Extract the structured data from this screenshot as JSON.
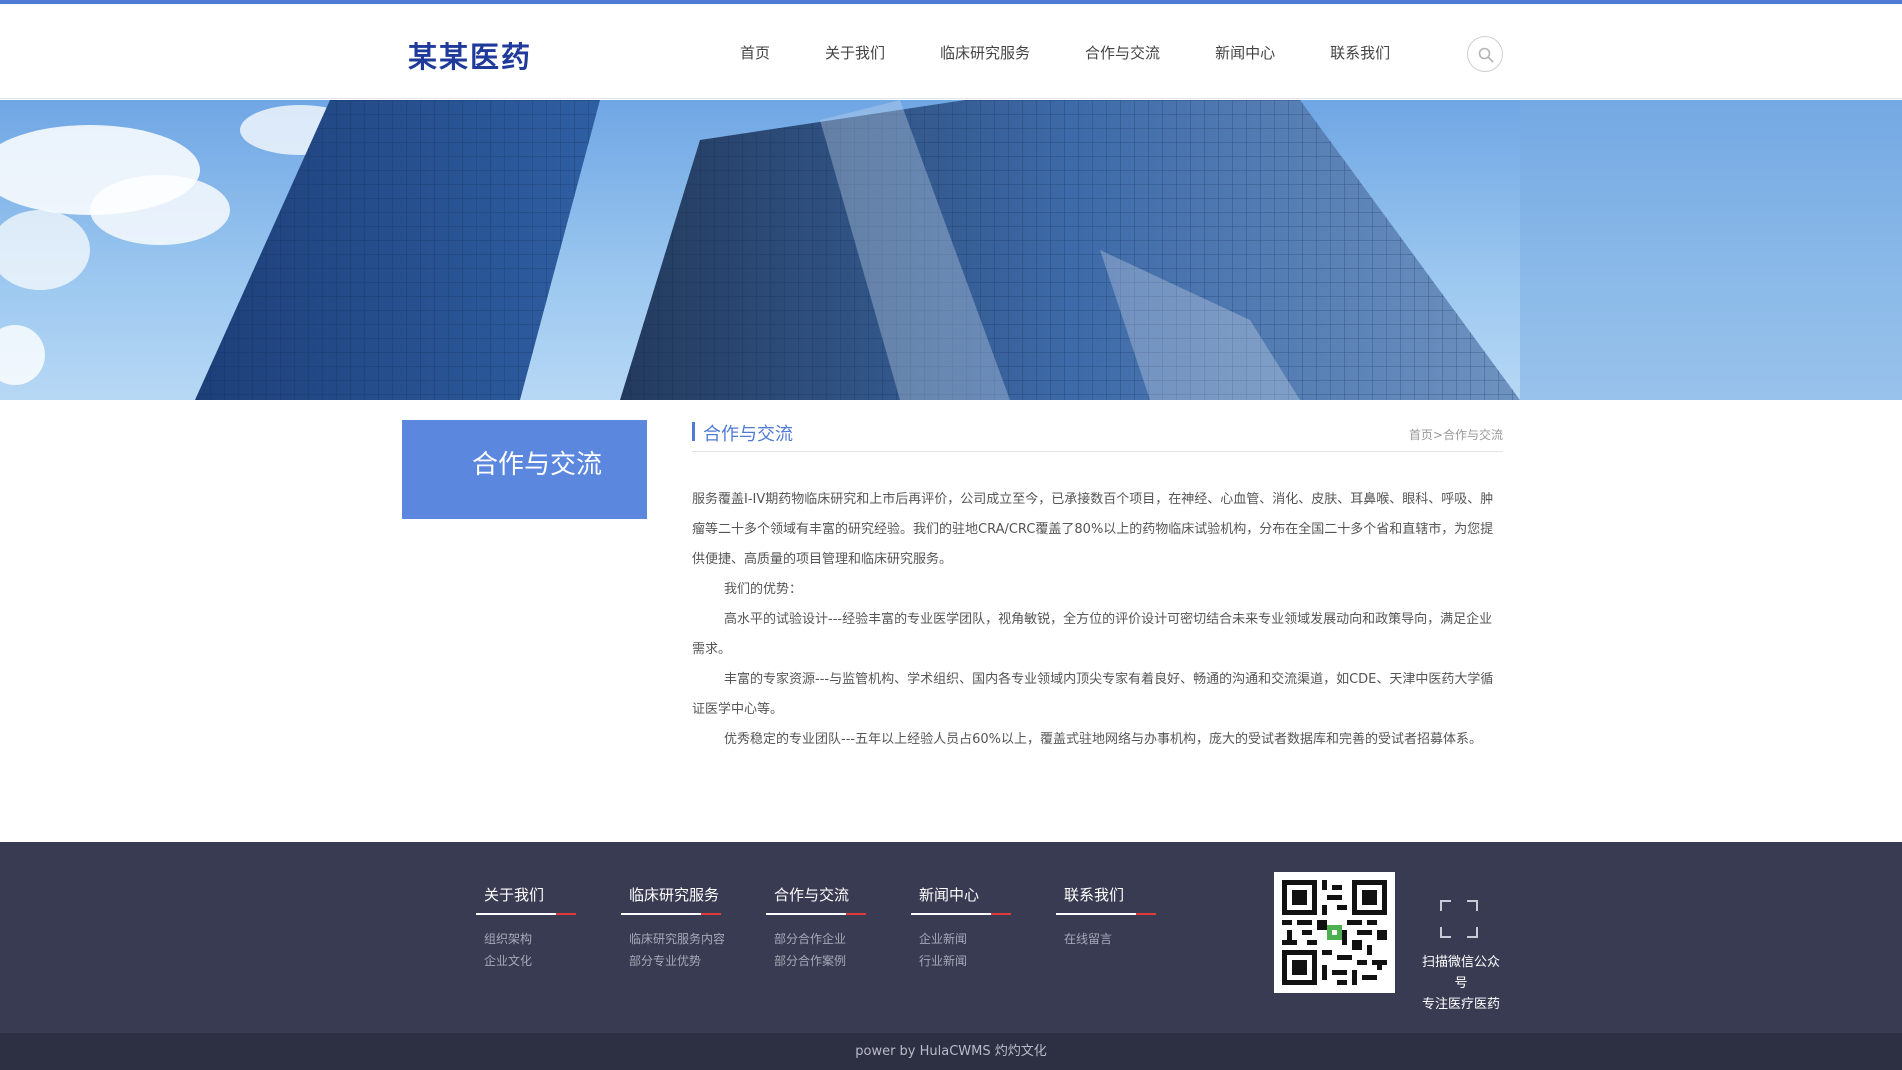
{
  "header": {
    "logo": "某某医药",
    "nav": [
      "首页",
      "关于我们",
      "临床研究服务",
      "合作与交流",
      "新闻中心",
      "联系我们"
    ],
    "search_icon": "search-icon"
  },
  "sidebar": {
    "title": "合作与交流"
  },
  "content": {
    "title": "合作与交流",
    "breadcrumb": {
      "home": "首页",
      "sep": ">",
      "current": "合作与交流"
    },
    "paragraphs": [
      " 服务覆盖I-IV期药物临床研究和上市后再评价，公司成立至今，已承接数百个项目，在神经、心血管、消化、皮肤、耳鼻喉、眼科、呼吸、肿瘤等二十多个领域有丰富的研究经验。我们的驻地CRA/CRC覆盖了80%以上的药物临床试验机构，分布在全国二十多个省和直辖市，为您提供便捷、高质量的项目管理和临床研究服务。",
      "我们的优势：",
      "高水平的试验设计---经验丰富的专业医学团队，视角敏锐，全方位的评价设计可密切结合未来专业领域发展动向和政策导向，满足企业需求。",
      "丰富的专家资源---与监管机构、学术组织、国内各专业领域内顶尖专家有着良好、畅通的沟通和交流渠道，如CDE、天津中医药大学循证医学中心等。",
      "优秀稳定的专业团队---五年以上经验人员占60%以上，覆盖式驻地网络与办事机构，庞大的受试者数据库和完善的受试者招募体系。"
    ]
  },
  "footer": {
    "columns": [
      {
        "title": "关于我们",
        "links": [
          "组织架构",
          "企业文化"
        ]
      },
      {
        "title": "临床研究服务",
        "links": [
          "临床研究服务内容",
          "部分专业优势"
        ]
      },
      {
        "title": "合作与交流",
        "links": [
          "部分合作企业",
          "部分合作案例"
        ]
      },
      {
        "title": "新闻中心",
        "links": [
          "企业新闻",
          "行业新闻"
        ]
      },
      {
        "title": "联系我们",
        "links": [
          "在线留言"
        ]
      }
    ],
    "qr_icon": "qr-code-icon",
    "scan_icon": "scan-icon",
    "scan_text": [
      "扫描微信公众号",
      "专注医疗医药"
    ]
  },
  "copyright": "power by HulaCWMS 灼灼文化",
  "colors": {
    "accent": "#4f7ad6",
    "logo": "#1f3a9a",
    "sidebar_bg": "#5b88de",
    "footer_bg": "#383b52",
    "copyright_bg": "#2d2f43",
    "footer_underline_accent": "#e03a3a"
  }
}
